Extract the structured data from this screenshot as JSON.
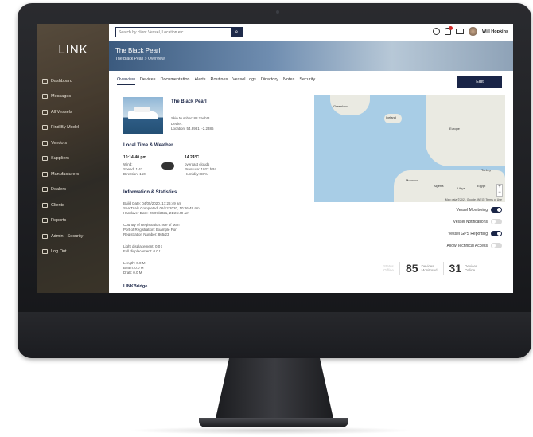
{
  "app": {
    "logo": "LINK"
  },
  "sidebar": {
    "items": [
      {
        "label": "Dashboard"
      },
      {
        "label": "Messages"
      },
      {
        "label": "All Vessels"
      },
      {
        "label": "Find By Model"
      },
      {
        "label": "Vendors"
      },
      {
        "label": "Suppliers"
      },
      {
        "label": "Manufacturers"
      },
      {
        "label": "Dealers"
      },
      {
        "label": "Clients"
      },
      {
        "label": "Reports"
      },
      {
        "label": "Admin - Security"
      },
      {
        "label": "Log Out"
      }
    ]
  },
  "topbar": {
    "search_placeholder": "Search by client Vessel, Location etc...",
    "user_name": "Will Hopkins"
  },
  "banner": {
    "title": "The Black Pearl",
    "breadcrumb": "The Black Pearl > Overview"
  },
  "tabs": [
    "Overview",
    "Devices",
    "Documentation",
    "Alerts",
    "Routines",
    "Vessel Logs",
    "Directory",
    "Notes",
    "Security"
  ],
  "edit_label": "Edit",
  "vessel": {
    "name": "The Black Pearl",
    "skin_number": "Skin Number: 88 Yacht8",
    "dealer": "Dealer:",
    "location": "Location: 54.8981, -2.2386"
  },
  "weather": {
    "heading": "Local Time & Weather",
    "time": "10:14:40 pm",
    "temp": "14.24°C",
    "wind": "Wind:",
    "speed": "Speed: 1.47",
    "direction": "Direction: 150",
    "conditions": "overcast clouds",
    "pressure": "Pressure: 1022 hPa",
    "humidity": "Humidity: 88%"
  },
  "info": {
    "heading": "Information & Statistics",
    "build_date": "Build Date: 04/05/2020, 17:26:49 am",
    "sea_trials": "Sea Trials Completed: 06/12/2020, 10:26:49 am",
    "handover": "Handover Date: 20/07/2021, 21:26:49 am",
    "country": "Country of Registration: Isle of Man",
    "port": "Port of Registration: Example Port",
    "reg_number": "Registration Number: 865/23",
    "light_disp": "Light displacement: 0.0 t",
    "full_disp": "Full displacement: 0.0 t",
    "length": "Length: 0.0 M",
    "beam": "Beam: 0.0 M",
    "draft": "Draft: 0.0 M",
    "linkbridge": "LINKBridge"
  },
  "map": {
    "labels": [
      "Greenland",
      "Iceland",
      "Europe",
      "Morocco",
      "Algeria",
      "Libya",
      "Egypt",
      "Turkey"
    ],
    "attribution": "Map data ©2021 Google, INEGI  Terms of Use"
  },
  "toggles": [
    {
      "label": "Vessel Monitoring",
      "on": true
    },
    {
      "label": "Vessel Notifications",
      "on": false
    },
    {
      "label": "Vessel GPS Reporting",
      "on": true
    },
    {
      "label": "Allow Technical Access",
      "on": false
    }
  ],
  "stats": {
    "status_label": "Status",
    "status_value": "Offline",
    "monitored_num": "85",
    "monitored_l1": "Devices",
    "monitored_l2": "Monitored",
    "online_num": "31",
    "online_l1": "Devices",
    "online_l2": "Online"
  },
  "colors": {
    "primary": "#1a2547",
    "accent_badge": "#d12b2b"
  }
}
